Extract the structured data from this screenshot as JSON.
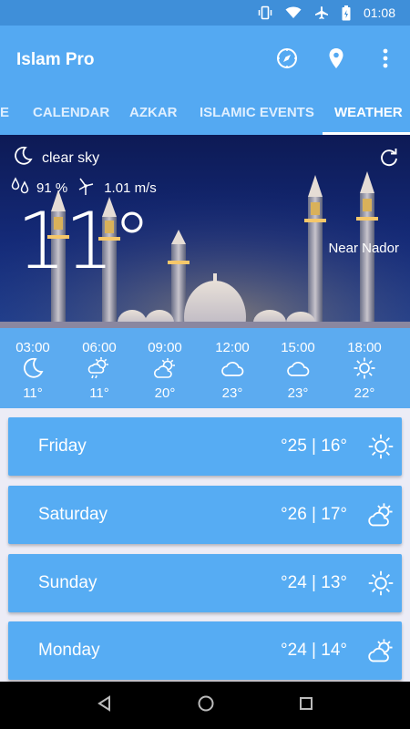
{
  "status_bar": {
    "time": "01:08",
    "icons": [
      "vibrate-icon",
      "wifi-icon",
      "airplane-icon",
      "battery-icon"
    ]
  },
  "app_bar": {
    "title": "Islam Pro",
    "actions": [
      "compass-icon",
      "location-pin-icon",
      "more-vert-icon"
    ]
  },
  "tabs": [
    {
      "label": "E"
    },
    {
      "label": "CALENDAR"
    },
    {
      "label": "AZKAR"
    },
    {
      "label": "ISLAMIC EVENTS"
    },
    {
      "label": "WEATHER",
      "active": true
    }
  ],
  "current": {
    "condition": "clear sky",
    "condition_icon": "moon-icon",
    "humidity": "91 %",
    "wind": "1.01 m/s",
    "temperature": "11°",
    "location": "Near Nador"
  },
  "hourly": [
    {
      "time": "03:00",
      "icon": "moon-icon",
      "temp": "11°"
    },
    {
      "time": "06:00",
      "icon": "sun-rain-icon",
      "temp": "11°"
    },
    {
      "time": "09:00",
      "icon": "partly-cloudy-icon",
      "temp": "20°"
    },
    {
      "time": "12:00",
      "icon": "cloud-icon",
      "temp": "23°"
    },
    {
      "time": "15:00",
      "icon": "cloud-icon",
      "temp": "23°"
    },
    {
      "time": "18:00",
      "icon": "sun-icon",
      "temp": "22°"
    }
  ],
  "daily": [
    {
      "day": "Friday",
      "range": "°25 | 16°",
      "icon": "sun-icon"
    },
    {
      "day": "Saturday",
      "range": "°26 | 17°",
      "icon": "partly-cloudy-icon"
    },
    {
      "day": "Sunday",
      "range": "°24 | 13°",
      "icon": "sun-icon"
    },
    {
      "day": "Monday",
      "range": "°24 | 14°",
      "icon": "partly-cloudy-icon"
    }
  ],
  "colors": {
    "primary": "#54a9f2",
    "status_bar": "#3f8fd9",
    "card": "#56acf3",
    "hourly_bg": "#5cabf0"
  }
}
